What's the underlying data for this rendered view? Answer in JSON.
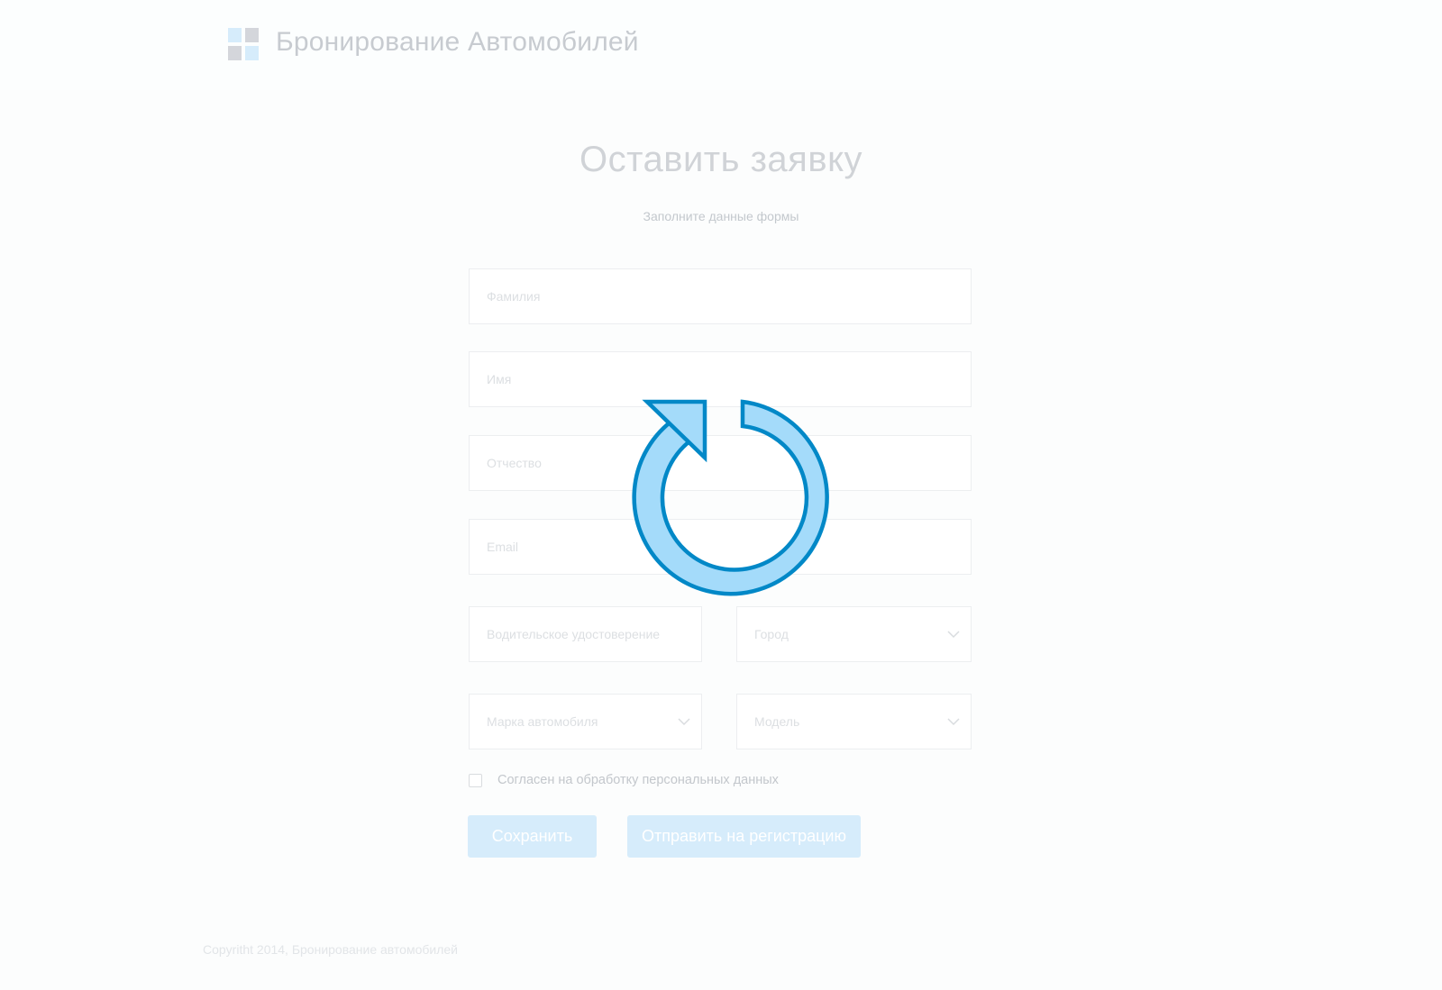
{
  "header": {
    "brand_title": "Бронирование Автомобилей",
    "logo_icon": "grid-logo-icon"
  },
  "form": {
    "title": "Оставить заявку",
    "subtitle": "Заполните данные формы",
    "fields": {
      "last_name": {
        "placeholder": "Фамилия",
        "value": ""
      },
      "first_name": {
        "placeholder": "Имя",
        "value": ""
      },
      "patronymic": {
        "placeholder": "Отчество",
        "value": ""
      },
      "email": {
        "placeholder": "Email",
        "value": ""
      },
      "license": {
        "placeholder": "Водительское удостоверение",
        "value": ""
      }
    },
    "selects": {
      "city": {
        "label": "Город"
      },
      "car_brand": {
        "label": "Марка автомобиля"
      },
      "model": {
        "label": "Модель"
      }
    },
    "consent": {
      "label": "Согласен на обработку персональных данных",
      "checked": false
    },
    "buttons": {
      "save": "Сохранить",
      "submit": "Отправить на регистрацию"
    }
  },
  "loader": {
    "icon": "refresh-icon"
  },
  "footer": {
    "copyright": "Copyritht 2014, Бронирование автомобилей"
  },
  "colors": {
    "accent": "#0288c7",
    "accent_light": "#a4dbfa",
    "button_bg": "#d6ecfb"
  }
}
